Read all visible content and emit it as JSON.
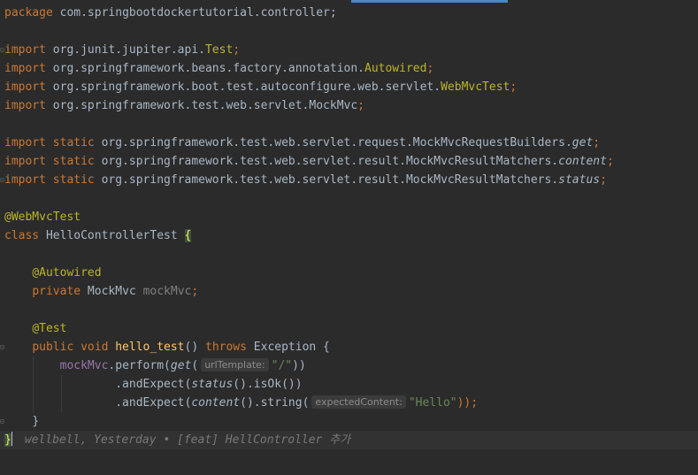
{
  "editor": {
    "line1": {
      "kw": "package",
      "rest": " com.springbootdockertutorial.controller;"
    },
    "line3": {
      "kw": "import",
      "pkg": " org.junit.jupiter.api.",
      "cls": "Test",
      "end": ";"
    },
    "line4": {
      "kw": "import",
      "pkg": " org.springframework.beans.factory.annotation.",
      "cls": "Autowired",
      "end": ";"
    },
    "line5": {
      "kw": "import",
      "pkg": " org.springframework.boot.test.autoconfigure.web.servlet.",
      "cls": "WebMvcTest",
      "end": ";"
    },
    "line6": {
      "kw": "import",
      "pkg": " org.springframework.test.web.servlet.MockMvc",
      "end": ";"
    },
    "line8": {
      "kw": "import static",
      "pkg": " org.springframework.test.web.servlet.request.MockMvcRequestBuilders.",
      "member": "get",
      "end": ";"
    },
    "line9": {
      "kw": "import static",
      "pkg": " org.springframework.test.web.servlet.result.MockMvcResultMatchers.",
      "member": "content",
      "end": ";"
    },
    "line10": {
      "kw": "import static",
      "pkg": " org.springframework.test.web.servlet.result.MockMvcResultMatchers.",
      "member": "status",
      "end": ";"
    },
    "line12": {
      "ann": "@WebMvcTest"
    },
    "line13": {
      "kw": "class",
      "name": " HelloControllerTest ",
      "brace": "{"
    },
    "line15": {
      "ann": "@Autowired"
    },
    "line16": {
      "kw": "private",
      "type": " MockMvc ",
      "field": "mockMvc",
      "end": ";"
    },
    "line18": {
      "ann": "@Test"
    },
    "line19": {
      "kw1": "public void ",
      "method": "hello_test",
      "parens": "() ",
      "kw2": "throws",
      "rest": " Exception {"
    },
    "line20": {
      "field": "mockMvc",
      "call": ".perform(",
      "fn": "get",
      "open": "(",
      "hint": "urlTemplate:",
      "str": "\"/\"",
      "close": "))"
    },
    "line21": {
      "call": ".andExpect(",
      "fn": "status",
      "rest": "().isOk())"
    },
    "line22": {
      "call": ".andExpect(",
      "fn": "content",
      "mid": "().string(",
      "hint": "expectedContent:",
      "str": "\"Hello\"",
      "end": "));"
    },
    "line23": {
      "brace": "}"
    },
    "line24": {
      "brace": "}",
      "blame": "wellbell, Yesterday • [feat] HellController 추가"
    }
  }
}
